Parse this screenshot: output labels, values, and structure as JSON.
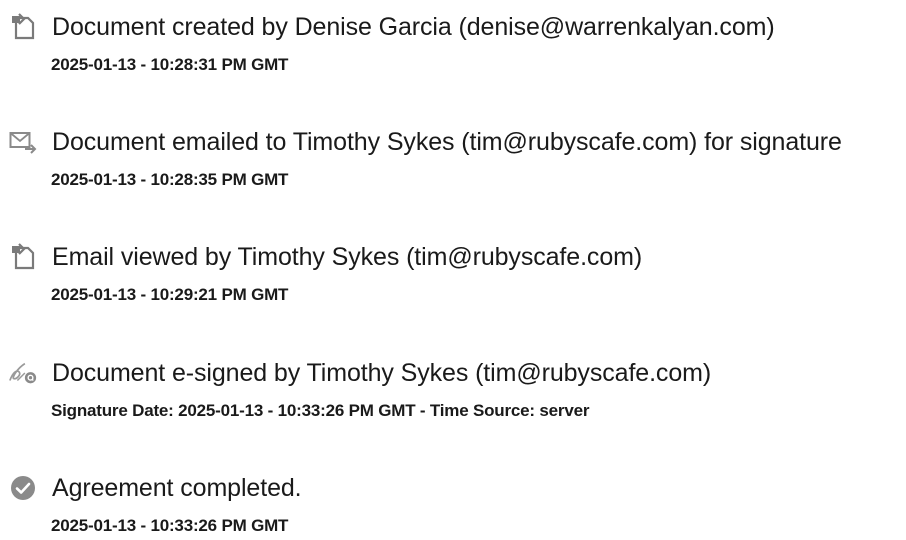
{
  "events": [
    {
      "icon": "document-created-icon",
      "title": "Document created by Denise Garcia (denise@warrenkalyan.com)",
      "meta": "2025-01-13 - 10:28:31 PM GMT"
    },
    {
      "icon": "email-sent-icon",
      "title": "Document emailed to Timothy Sykes (tim@rubyscafe.com) for signature",
      "meta": "2025-01-13 - 10:28:35 PM GMT"
    },
    {
      "icon": "email-viewed-icon",
      "title": "Email viewed by Timothy Sykes (tim@rubyscafe.com)",
      "meta": "2025-01-13 - 10:29:21 PM GMT"
    },
    {
      "icon": "e-signature-icon",
      "title": "Document e-signed by Timothy Sykes (tim@rubyscafe.com)",
      "meta": "Signature Date: 2025-01-13 - 10:33:26 PM GMT - Time Source: server"
    },
    {
      "icon": "checkmark-circle-icon",
      "title": "Agreement completed.",
      "meta": "2025-01-13 - 10:33:26 PM GMT"
    }
  ],
  "colors": {
    "icon_gray": "#8a8a8a",
    "text": "#1a1a1a"
  }
}
